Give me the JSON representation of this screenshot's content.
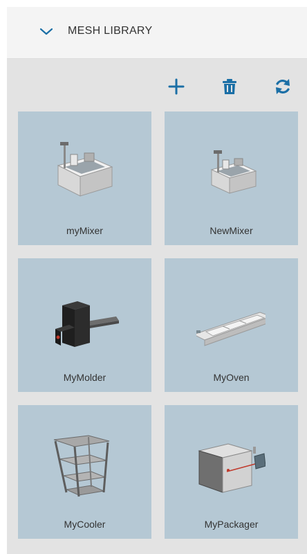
{
  "header": {
    "title": "MESH LIBRARY",
    "toggle_icon": "chevron-down-icon"
  },
  "toolbar": {
    "add_icon": "plus-icon",
    "delete_icon": "trash-icon",
    "refresh_icon": "refresh-icon"
  },
  "colors": {
    "accent": "#1b6fa6",
    "card_bg": "#b5c8d4",
    "panel_bg": "#e3e3e3",
    "header_bg": "#f4f4f4"
  },
  "meshes": [
    {
      "name": "myMixer",
      "icon": "mixer-model-icon"
    },
    {
      "name": "NewMixer",
      "icon": "mixer-model-icon"
    },
    {
      "name": "MyMolder",
      "icon": "molder-model-icon"
    },
    {
      "name": "MyOven",
      "icon": "oven-model-icon"
    },
    {
      "name": "MyCooler",
      "icon": "cooler-rack-model-icon"
    },
    {
      "name": "MyPackager",
      "icon": "packager-model-icon"
    }
  ]
}
